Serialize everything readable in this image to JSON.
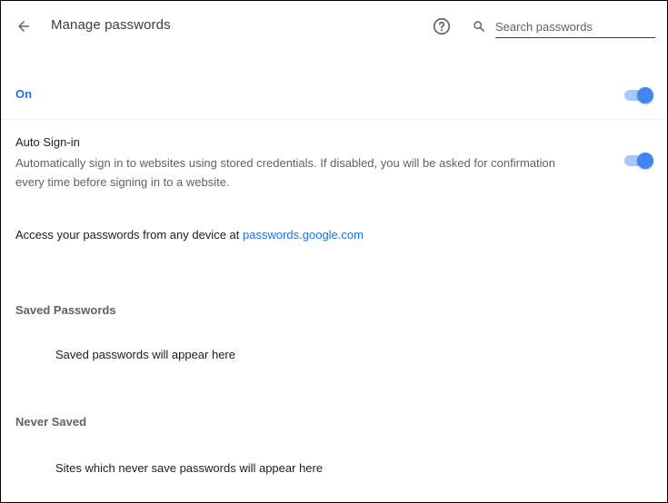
{
  "header": {
    "title": "Manage passwords",
    "back_icon": "arrow-back-icon",
    "help_icon": "help-circle-icon",
    "search": {
      "icon": "search-icon",
      "placeholder": "Search passwords",
      "value": ""
    }
  },
  "save_passwords": {
    "label": "On",
    "enabled": true
  },
  "auto_signin": {
    "title": "Auto Sign-in",
    "description": "Automatically sign in to websites using stored credentials. If disabled, you will be asked for confirmation every time before signing in to a website.",
    "enabled": true
  },
  "access": {
    "text": "Access your passwords from any device at ",
    "link_text": "passwords.google.com"
  },
  "saved_passwords": {
    "heading": "Saved Passwords",
    "empty_text": "Saved passwords will appear here"
  },
  "never_saved": {
    "heading": "Never Saved",
    "empty_text": "Sites which never save passwords will appear here"
  },
  "colors": {
    "accent": "#1a73e8",
    "toggle_knob": "#4285f4",
    "toggle_track": "#a8c7fa",
    "secondary_text": "#5f6368"
  }
}
